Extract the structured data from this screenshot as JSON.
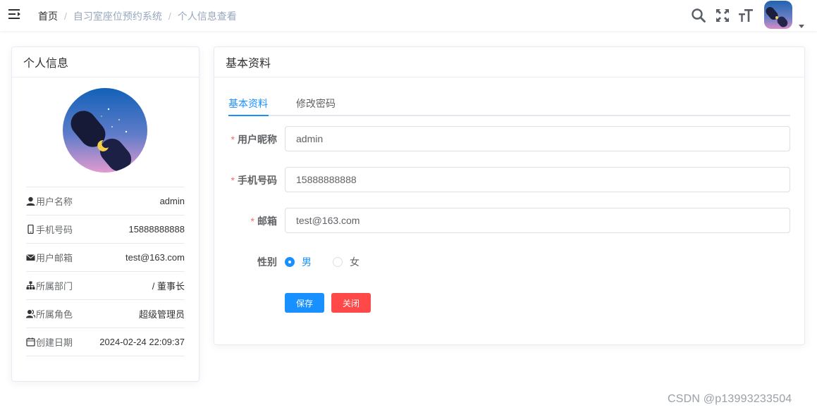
{
  "navbar": {
    "breadcrumb": [
      "首页",
      "自习室座位预约系统",
      "个人信息查看"
    ],
    "separator": "/",
    "icons": [
      "hamburger-icon",
      "search-icon",
      "fullscreen-icon",
      "text-size-icon",
      "user-avatar",
      "caret-down-icon"
    ]
  },
  "profile_card": {
    "title": "个人信息",
    "rows": [
      {
        "icon": "user-icon",
        "label": "用户名称",
        "value": "admin"
      },
      {
        "icon": "phone-icon",
        "label": "手机号码",
        "value": "15888888888"
      },
      {
        "icon": "mail-icon",
        "label": "用户邮箱",
        "value": "test@163.com"
      },
      {
        "icon": "tree-icon",
        "label": "所属部门",
        "value": "/ 董事长"
      },
      {
        "icon": "peoples-icon",
        "label": "所属角色",
        "value": "超级管理员"
      },
      {
        "icon": "date-icon",
        "label": "创建日期",
        "value": "2024-02-24 22:09:37"
      }
    ]
  },
  "basic_card": {
    "title": "基本资料",
    "tabs": [
      "基本资料",
      "修改密码"
    ],
    "active_tab": "基本资料",
    "form": {
      "nickname": {
        "label": "用户昵称",
        "value": "admin",
        "required": true
      },
      "phone": {
        "label": "手机号码",
        "value": "15888888888",
        "required": true
      },
      "email": {
        "label": "邮箱",
        "value": "test@163.com",
        "required": true
      },
      "gender": {
        "label": "性别",
        "options": [
          "男",
          "女"
        ],
        "selected": "男"
      }
    },
    "buttons": {
      "save": "保存",
      "close": "关闭"
    }
  },
  "watermark": "CSDN @p13993233504",
  "colors": {
    "primary": "#1890ff",
    "danger": "#ff4949",
    "required": "#f56c6c"
  }
}
